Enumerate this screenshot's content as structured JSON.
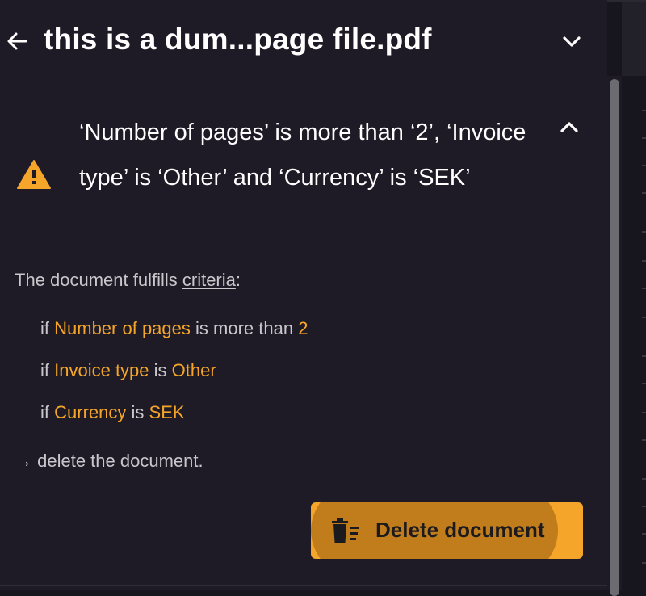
{
  "header": {
    "title": "this is a dum...page file.pdf",
    "back_icon": "arrow-left-icon",
    "toggle_icon": "chevron-down-icon"
  },
  "rule": {
    "title": "‘Number of pages’ is more than ‘2’, ‘Invoice type’ is ‘Other’ and ‘Currency’ is ‘SEK’",
    "warning_icon": "warning-triangle-icon",
    "collapse_icon": "chevron-up-icon",
    "warning_color": "#f5a62a"
  },
  "details": {
    "fulfills_prefix": "The document fulfills ",
    "criteria_link": "criteria",
    "fulfills_suffix": ":",
    "conditions": [
      {
        "if": "if",
        "field": "Number of pages",
        "op": "is more than",
        "value": "2"
      },
      {
        "if": "if",
        "field": "Invoice type",
        "op": "is",
        "value": "Other"
      },
      {
        "if": "if",
        "field": "Currency",
        "op": "is",
        "value": "SEK"
      }
    ],
    "action_arrow": "→",
    "action_text": "delete the document."
  },
  "button": {
    "label": "Delete document",
    "icon": "trash-delete-icon",
    "color": "#f5a62a"
  },
  "colors": {
    "highlight": "#f5a62a",
    "panel": "#1e1b26"
  }
}
